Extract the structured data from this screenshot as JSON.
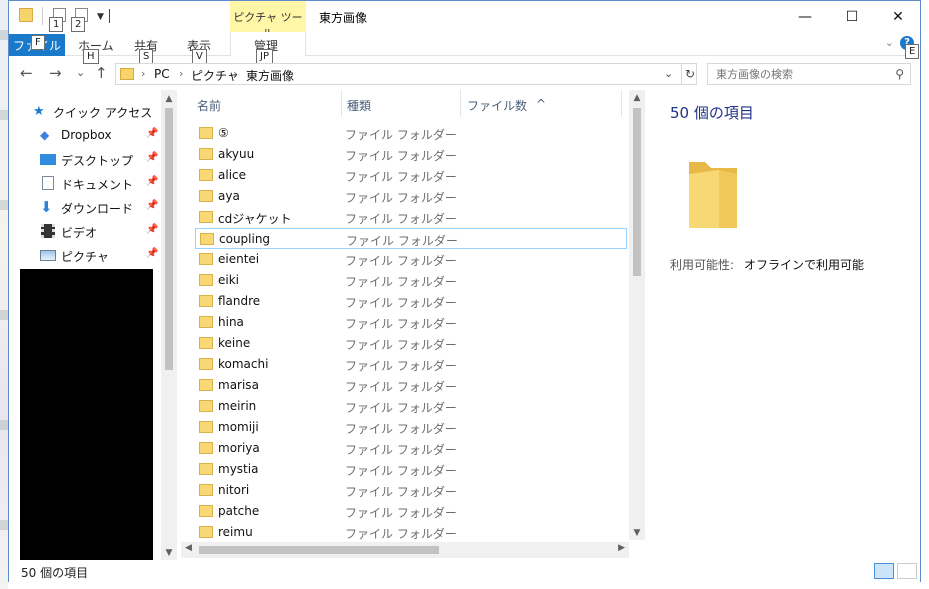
{
  "titlebar": {
    "title": "東方画像",
    "context_tab": "ピクチャ ツール",
    "qat_keytips": [
      "1",
      "2"
    ],
    "minimize": "—",
    "maximize": "☐",
    "close": "✕"
  },
  "ribbon": {
    "file_tab": "ファイル",
    "file_keytip": "F",
    "tabs": [
      {
        "label": "ホーム",
        "keytip": "H"
      },
      {
        "label": "共有",
        "keytip": "S"
      },
      {
        "label": "表示",
        "keytip": "V"
      },
      {
        "label": "管理",
        "keytip": "JP"
      }
    ],
    "help_keytip": "E"
  },
  "nav": {
    "back": "←",
    "forward": "→",
    "recent": "⌄",
    "up": "↑"
  },
  "address": {
    "crumbs": [
      "PC",
      "ピクチャ",
      "東方画像"
    ]
  },
  "search": {
    "placeholder": "東方画像の検索"
  },
  "navpane": {
    "items": [
      {
        "label": "クイック アクセス",
        "icon": "star-icon"
      },
      {
        "label": "Dropbox",
        "icon": "dropbox-icon"
      },
      {
        "label": "デスクトップ",
        "icon": "desktop-icon"
      },
      {
        "label": "ドキュメント",
        "icon": "document-icon"
      },
      {
        "label": "ダウンロード",
        "icon": "download-icon"
      },
      {
        "label": "ビデオ",
        "icon": "video-icon"
      },
      {
        "label": "ピクチャ",
        "icon": "picture-icon"
      }
    ]
  },
  "list": {
    "columns": [
      "名前",
      "種類",
      "ファイル数"
    ],
    "rows": [
      {
        "name": "⑤",
        "type": "ファイル フォルダー"
      },
      {
        "name": "akyuu",
        "type": "ファイル フォルダー"
      },
      {
        "name": "alice",
        "type": "ファイル フォルダー"
      },
      {
        "name": "aya",
        "type": "ファイル フォルダー"
      },
      {
        "name": "cdジャケット",
        "type": "ファイル フォルダー"
      },
      {
        "name": "coupling",
        "type": "ファイル フォルダー"
      },
      {
        "name": "eientei",
        "type": "ファイル フォルダー"
      },
      {
        "name": "eiki",
        "type": "ファイル フォルダー"
      },
      {
        "name": "flandre",
        "type": "ファイル フォルダー"
      },
      {
        "name": "hina",
        "type": "ファイル フォルダー"
      },
      {
        "name": "keine",
        "type": "ファイル フォルダー"
      },
      {
        "name": "komachi",
        "type": "ファイル フォルダー"
      },
      {
        "name": "marisa",
        "type": "ファイル フォルダー"
      },
      {
        "name": "meirin",
        "type": "ファイル フォルダー"
      },
      {
        "name": "momiji",
        "type": "ファイル フォルダー"
      },
      {
        "name": "moriya",
        "type": "ファイル フォルダー"
      },
      {
        "name": "mystia",
        "type": "ファイル フォルダー"
      },
      {
        "name": "nitori",
        "type": "ファイル フォルダー"
      },
      {
        "name": "patche",
        "type": "ファイル フォルダー"
      },
      {
        "name": "reimu",
        "type": "ファイル フォルダー"
      }
    ],
    "selected_name": "coupling"
  },
  "details": {
    "title": "50 個の項目",
    "availability_label": "利用可能性:",
    "availability_value": "オフラインで利用可能"
  },
  "status": {
    "count": "50 個の項目"
  },
  "colors": {
    "accent": "#1979ca",
    "folder": "#f8d775",
    "context_tab": "#fff6a8",
    "selection_border": "#99d1ff"
  }
}
